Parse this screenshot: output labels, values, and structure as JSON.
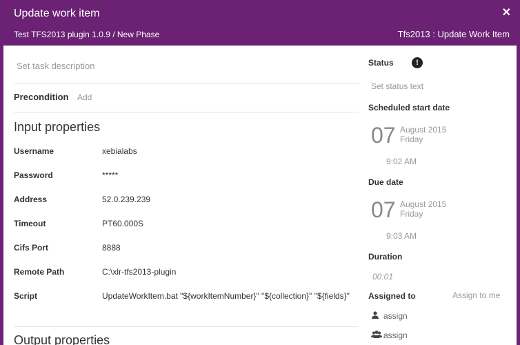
{
  "header": {
    "title": "Update work item",
    "breadcrumb": "Test TFS2013 plugin 1.0.9 / New Phase",
    "task_type": "Tfs2013 : Update Work Item",
    "close_glyph": "✕"
  },
  "left": {
    "description_placeholder": "Set task description",
    "precondition_label": "Precondition",
    "precondition_add": "Add",
    "input_title": "Input properties",
    "properties": [
      {
        "label": "Username",
        "value": "xebialabs"
      },
      {
        "label": "Password",
        "value": "*****"
      },
      {
        "label": "Address",
        "value": "52.0.239.239"
      },
      {
        "label": "Timeout",
        "value": "PT60.000S"
      },
      {
        "label": "Cifs Port",
        "value": "8888"
      },
      {
        "label": "Remote Path",
        "value": "C:\\xlr-tfs2013-plugin"
      },
      {
        "label": "Script",
        "value": "UpdateWorkItem.bat \"${workItemNumber}\" \"${collection}\" \"${fields}\""
      }
    ],
    "output_title": "Output properties"
  },
  "right": {
    "status_label": "Status",
    "status_icon": "exclamation-icon",
    "status_placeholder": "Set status text",
    "start_label": "Scheduled start date",
    "start": {
      "day": "07",
      "month_year": "August 2015",
      "weekday": "Friday",
      "time": "9:02 AM"
    },
    "due_label": "Due date",
    "due": {
      "day": "07",
      "month_year": "August 2015",
      "weekday": "Friday",
      "time": "9:03 AM"
    },
    "duration_label": "Duration",
    "duration_value": "00:01",
    "assigned_label": "Assigned to",
    "assign_to_me": "Assign to me",
    "assign_user": "assign",
    "assign_team": "assign"
  },
  "colors": {
    "header": "#6b2174"
  }
}
